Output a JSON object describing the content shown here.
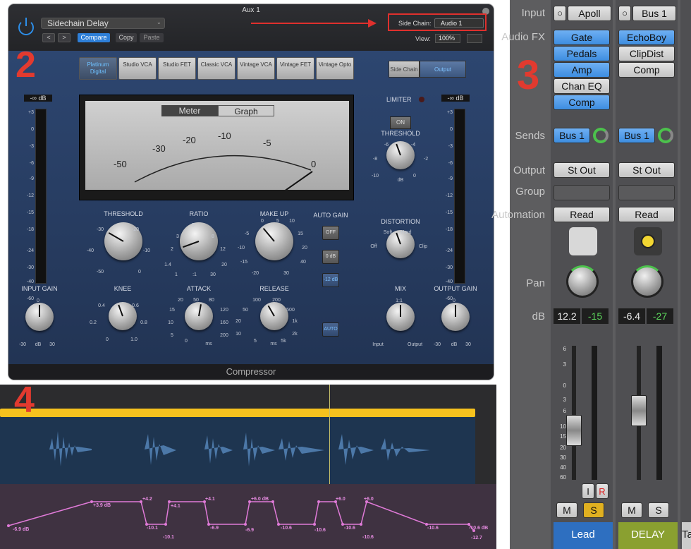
{
  "annotations": {
    "n2": "2",
    "n3": "3",
    "n4": "4"
  },
  "plugin": {
    "window_title": "Aux 1",
    "preset": "Sidechain Delay",
    "nav_prev": "<",
    "nav_next": ">",
    "compare": "Compare",
    "copy": "Copy",
    "paste": "Paste",
    "sidechain_label": "Side Chain:",
    "sidechain_value": "Audio 1",
    "view_label": "View:",
    "view_value": "100%",
    "footer": "Compressor",
    "models": [
      "Platinum Digital",
      "Studio VCA",
      "Studio FET",
      "Classic VCA",
      "Vintage VCA",
      "Vintage FET",
      "Vintage Opto"
    ],
    "selected_model": "Platinum Digital",
    "sc_buttons": [
      "Side Chain",
      "Output"
    ],
    "meter_tabs": [
      "Meter",
      "Graph"
    ],
    "meter_scale": [
      "-50",
      "-30",
      "-20",
      "-10",
      "-5",
      "0"
    ],
    "left_meter_db": "-∞ dB",
    "right_meter_db": "-∞ dB",
    "meter_ticks": [
      "+3",
      "0",
      "-3",
      "-6",
      "-9",
      "-12",
      "-15",
      "-18",
      "-24",
      "-30",
      "-40",
      "-60"
    ],
    "knobs": {
      "threshold": {
        "label": "THRESHOLD",
        "ticks": [
          "-30",
          "-20",
          "-40",
          "-10",
          "-50",
          "0"
        ]
      },
      "ratio": {
        "label": "RATIO",
        "ticks": [
          "5",
          "3",
          "8",
          "2",
          "12",
          "1.4",
          "20",
          "1",
          ":1",
          "30"
        ]
      },
      "makeup": {
        "label": "MAKE UP",
        "ticks": [
          "0",
          "5",
          "10",
          "-5",
          "15",
          "-10",
          "20",
          "-15",
          "40",
          "-20",
          "30"
        ]
      },
      "knee": {
        "label": "KNEE",
        "ticks": [
          "0.4",
          "0.6",
          "0.2",
          "0.8",
          "0",
          "1.0"
        ]
      },
      "attack": {
        "label": "ATTACK",
        "ticks": [
          "20",
          "50",
          "80",
          "15",
          "120",
          "10",
          "160",
          "5",
          "200",
          "0",
          "ms"
        ]
      },
      "release": {
        "label": "RELEASE",
        "ticks": [
          "100",
          "200",
          "50",
          "500",
          "20",
          "1k",
          "10",
          "2k",
          "5",
          "5k",
          "ms"
        ]
      },
      "input_gain": {
        "label": "INPUT GAIN",
        "ticks": [
          "0",
          "-30",
          "dB",
          "30"
        ]
      },
      "output_gain": {
        "label": "OUTPUT GAIN",
        "ticks": [
          "0",
          "-30",
          "dB",
          "30"
        ]
      },
      "lim_threshold": {
        "label": "THRESHOLD",
        "ticks": [
          "-6",
          "-4",
          "-8",
          "-2",
          "-10",
          "dB",
          "0"
        ]
      },
      "distortion": {
        "label": "DISTORTION",
        "ticks": [
          "Soft",
          "Hard",
          "Off",
          "Clip"
        ]
      },
      "mix": {
        "label": "MIX",
        "ticks": [
          "1:1",
          "Input",
          "Output"
        ]
      }
    },
    "auto_gain": {
      "label": "AUTO GAIN",
      "buttons": [
        "OFF",
        "0 dB",
        "-12 dB"
      ],
      "selected": "-12 dB"
    },
    "auto_button": "AUTO",
    "limiter": {
      "label": "LIMITER",
      "button": "ON"
    }
  },
  "automation": {
    "labels": [
      "-6.9 dB",
      "+3.9 dB",
      "+4.2",
      "+4.1",
      "-10.1",
      "-10.1",
      "+4.1",
      "-6.9",
      "-6.9",
      "+6.0 dB",
      "-10.6",
      "-10.6",
      "+6.0",
      "+6.0",
      "-10.6",
      "-10.6",
      "-10.6",
      "-10.6 dB",
      "-12.7"
    ]
  },
  "mixer": {
    "row_labels": [
      "Input",
      "Audio FX",
      "Sends",
      "Output",
      "Group",
      "Automation",
      "Pan",
      "dB"
    ],
    "channels": [
      {
        "input": "Apoll",
        "fx": [
          "Gate",
          "Pedals",
          "Amp",
          "Chan EQ",
          "Comp"
        ],
        "fx_blue": [
          true,
          true,
          true,
          false,
          true
        ],
        "send": "Bus 1",
        "output": "St Out",
        "automation": "Read",
        "db": "12.2",
        "peak": "-15",
        "name": "Lead",
        "mute": "M",
        "solo": "S",
        "input_btn": "I",
        "rec_btn": "R"
      },
      {
        "input": "Bus 1",
        "fx": [
          "EchoBoy",
          "ClipDist",
          "Comp"
        ],
        "fx_blue": [
          true,
          false,
          false
        ],
        "send": "Bus 1",
        "output": "St Out",
        "automation": "Read",
        "db": "-6.4",
        "peak": "-27",
        "name": "DELAY",
        "mute": "M",
        "solo": "S"
      }
    ],
    "fader_ticks": [
      "6",
      "3",
      "0",
      "3",
      "6",
      "10",
      "15",
      "20",
      "30",
      "40",
      "60"
    ],
    "partial_tab": "Ta"
  }
}
